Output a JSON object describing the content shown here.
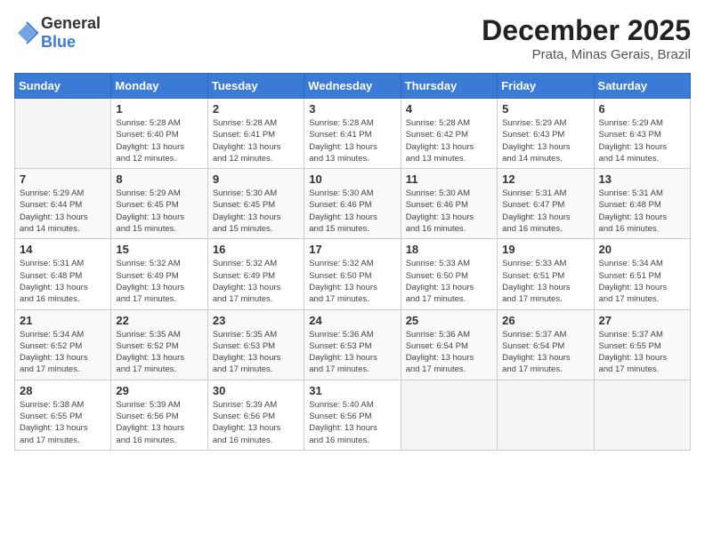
{
  "logo": {
    "general": "General",
    "blue": "Blue"
  },
  "title": "December 2025",
  "location": "Prata, Minas Gerais, Brazil",
  "weekdays": [
    "Sunday",
    "Monday",
    "Tuesday",
    "Wednesday",
    "Thursday",
    "Friday",
    "Saturday"
  ],
  "weeks": [
    [
      {
        "day": "",
        "info": ""
      },
      {
        "day": "1",
        "info": "Sunrise: 5:28 AM\nSunset: 6:40 PM\nDaylight: 13 hours\nand 12 minutes."
      },
      {
        "day": "2",
        "info": "Sunrise: 5:28 AM\nSunset: 6:41 PM\nDaylight: 13 hours\nand 12 minutes."
      },
      {
        "day": "3",
        "info": "Sunrise: 5:28 AM\nSunset: 6:41 PM\nDaylight: 13 hours\nand 13 minutes."
      },
      {
        "day": "4",
        "info": "Sunrise: 5:28 AM\nSunset: 6:42 PM\nDaylight: 13 hours\nand 13 minutes."
      },
      {
        "day": "5",
        "info": "Sunrise: 5:29 AM\nSunset: 6:43 PM\nDaylight: 13 hours\nand 14 minutes."
      },
      {
        "day": "6",
        "info": "Sunrise: 5:29 AM\nSunset: 6:43 PM\nDaylight: 13 hours\nand 14 minutes."
      }
    ],
    [
      {
        "day": "7",
        "info": "Sunrise: 5:29 AM\nSunset: 6:44 PM\nDaylight: 13 hours\nand 14 minutes."
      },
      {
        "day": "8",
        "info": "Sunrise: 5:29 AM\nSunset: 6:45 PM\nDaylight: 13 hours\nand 15 minutes."
      },
      {
        "day": "9",
        "info": "Sunrise: 5:30 AM\nSunset: 6:45 PM\nDaylight: 13 hours\nand 15 minutes."
      },
      {
        "day": "10",
        "info": "Sunrise: 5:30 AM\nSunset: 6:46 PM\nDaylight: 13 hours\nand 15 minutes."
      },
      {
        "day": "11",
        "info": "Sunrise: 5:30 AM\nSunset: 6:46 PM\nDaylight: 13 hours\nand 16 minutes."
      },
      {
        "day": "12",
        "info": "Sunrise: 5:31 AM\nSunset: 6:47 PM\nDaylight: 13 hours\nand 16 minutes."
      },
      {
        "day": "13",
        "info": "Sunrise: 5:31 AM\nSunset: 6:48 PM\nDaylight: 13 hours\nand 16 minutes."
      }
    ],
    [
      {
        "day": "14",
        "info": "Sunrise: 5:31 AM\nSunset: 6:48 PM\nDaylight: 13 hours\nand 16 minutes."
      },
      {
        "day": "15",
        "info": "Sunrise: 5:32 AM\nSunset: 6:49 PM\nDaylight: 13 hours\nand 17 minutes."
      },
      {
        "day": "16",
        "info": "Sunrise: 5:32 AM\nSunset: 6:49 PM\nDaylight: 13 hours\nand 17 minutes."
      },
      {
        "day": "17",
        "info": "Sunrise: 5:32 AM\nSunset: 6:50 PM\nDaylight: 13 hours\nand 17 minutes."
      },
      {
        "day": "18",
        "info": "Sunrise: 5:33 AM\nSunset: 6:50 PM\nDaylight: 13 hours\nand 17 minutes."
      },
      {
        "day": "19",
        "info": "Sunrise: 5:33 AM\nSunset: 6:51 PM\nDaylight: 13 hours\nand 17 minutes."
      },
      {
        "day": "20",
        "info": "Sunrise: 5:34 AM\nSunset: 6:51 PM\nDaylight: 13 hours\nand 17 minutes."
      }
    ],
    [
      {
        "day": "21",
        "info": "Sunrise: 5:34 AM\nSunset: 6:52 PM\nDaylight: 13 hours\nand 17 minutes."
      },
      {
        "day": "22",
        "info": "Sunrise: 5:35 AM\nSunset: 6:52 PM\nDaylight: 13 hours\nand 17 minutes."
      },
      {
        "day": "23",
        "info": "Sunrise: 5:35 AM\nSunset: 6:53 PM\nDaylight: 13 hours\nand 17 minutes."
      },
      {
        "day": "24",
        "info": "Sunrise: 5:36 AM\nSunset: 6:53 PM\nDaylight: 13 hours\nand 17 minutes."
      },
      {
        "day": "25",
        "info": "Sunrise: 5:36 AM\nSunset: 6:54 PM\nDaylight: 13 hours\nand 17 minutes."
      },
      {
        "day": "26",
        "info": "Sunrise: 5:37 AM\nSunset: 6:54 PM\nDaylight: 13 hours\nand 17 minutes."
      },
      {
        "day": "27",
        "info": "Sunrise: 5:37 AM\nSunset: 6:55 PM\nDaylight: 13 hours\nand 17 minutes."
      }
    ],
    [
      {
        "day": "28",
        "info": "Sunrise: 5:38 AM\nSunset: 6:55 PM\nDaylight: 13 hours\nand 17 minutes."
      },
      {
        "day": "29",
        "info": "Sunrise: 5:39 AM\nSunset: 6:56 PM\nDaylight: 13 hours\nand 16 minutes."
      },
      {
        "day": "30",
        "info": "Sunrise: 5:39 AM\nSunset: 6:56 PM\nDaylight: 13 hours\nand 16 minutes."
      },
      {
        "day": "31",
        "info": "Sunrise: 5:40 AM\nSunset: 6:56 PM\nDaylight: 13 hours\nand 16 minutes."
      },
      {
        "day": "",
        "info": ""
      },
      {
        "day": "",
        "info": ""
      },
      {
        "day": "",
        "info": ""
      }
    ]
  ]
}
